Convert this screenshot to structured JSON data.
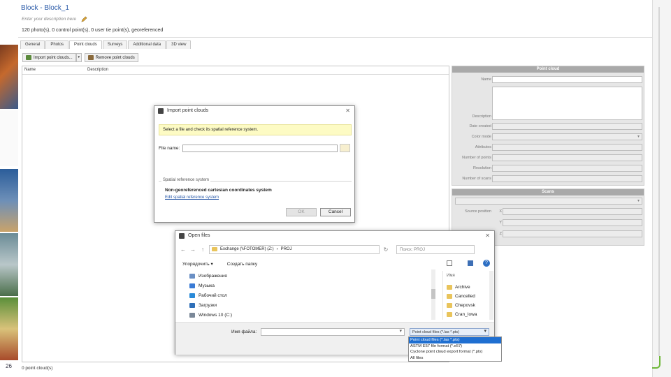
{
  "slide_number": "26",
  "header": {
    "title": "Block - Block_1",
    "description_placeholder": "Enter your description here",
    "stats": "120 photo(s), 0 control point(s), 0 user tie point(s), georeferenced"
  },
  "tabs": [
    {
      "label": "General"
    },
    {
      "label": "Photos"
    },
    {
      "label": "Point clouds"
    },
    {
      "label": "Surveys"
    },
    {
      "label": "Additional data"
    },
    {
      "label": "3D view"
    }
  ],
  "toolbar": {
    "import_label": "Import point clouds...",
    "remove_label": "Remove point clouds"
  },
  "list": {
    "col_name": "Name",
    "col_description": "Description",
    "status": "0 point cloud(s)"
  },
  "point_cloud_panel": {
    "title": "Point cloud",
    "fields": [
      "Name",
      "Description",
      "Date created",
      "Color mode",
      "Attributes",
      "Number of points",
      "Resolution",
      "Number of scans"
    ]
  },
  "origin_panel": {
    "title": "Scans",
    "source_position_label": "Source position",
    "axis_x": "X",
    "axis_y": "Y",
    "axis_z": "Z"
  },
  "import_dialog": {
    "title": "Import point clouds",
    "hint": "Select a file and check its spatial reference system.",
    "file_name_label": "File name:",
    "srs_label": "Spatial reference system",
    "srs_value": "Non-georeferenced cartesian coordinates system",
    "srs_link": "Edit spatial reference system",
    "ok_label": "OK",
    "cancel_label": "Cancel"
  },
  "open_dialog": {
    "title": "Open files",
    "path": [
      "Exchange (\\\\FOTOMER) (Z:)",
      "PROJ"
    ],
    "search_placeholder": "Поиск: PROJ",
    "organize_label": "Упорядочить ▾",
    "new_folder_label": "Создать папку",
    "tree_items": [
      "Изображения",
      "Музыка",
      "Рабочий стол",
      "Загрузки",
      "Windows 10 (C:)"
    ],
    "files_header": "Имя",
    "file_items": [
      "Archive",
      "Cancelled",
      "Chepovsk",
      "Cran_Iowa"
    ],
    "filename_label": "Имя файла:",
    "filter_value": "Point cloud files (*.las *.pts)"
  },
  "filter_dropdown": {
    "options": [
      "Point cloud files (*.las *.pts)",
      "ASTM E57 file format (*.e57)",
      "Cyclone point cloud export format (*.ptx)",
      "All files"
    ],
    "selected_index": 0
  },
  "colors": {
    "title_blue": "#2a5aa8",
    "hint_yellow": "#fdfbc4",
    "selection_blue": "#1f6fd1",
    "brand_green": "#6fb83b"
  }
}
